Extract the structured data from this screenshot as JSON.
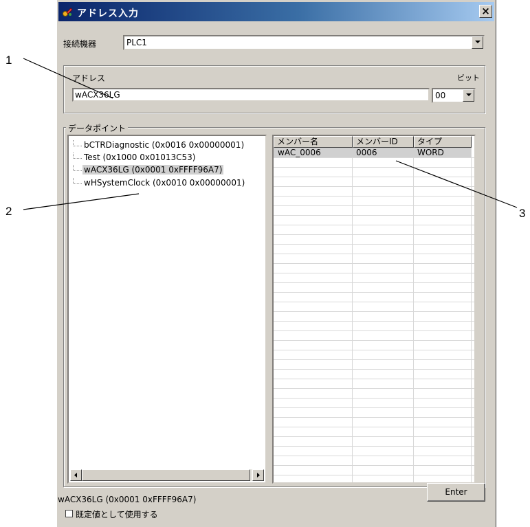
{
  "window": {
    "title": "アドレス入力",
    "close_symbol": "×"
  },
  "device": {
    "label": "接続機器",
    "value": "PLC1"
  },
  "address_group": {
    "label": "アドレス",
    "bit_label": "ビット",
    "value": "wACX36LG",
    "bit_value": "00"
  },
  "datapoint_group": {
    "label": "データポイント",
    "tree_items": [
      "bCTRDiagnostic (0x0016 0x00000001)",
      "Test (0x1000 0x01013C53)",
      "wACX36LG (0x0001 0xFFFF96A7)",
      "wHSystemClock (0x0010 0x00000001)"
    ],
    "selected_index": 2
  },
  "members_table": {
    "columns": [
      "メンバー名",
      "メンバーID",
      "タイプ"
    ],
    "rows": [
      [
        "wAC_0006",
        "0006",
        "WORD"
      ]
    ]
  },
  "status_text": "wACX36LG (0x0001 0xFFFF96A7)",
  "enter_button": "Enter",
  "default_checkbox": {
    "label": "既定値として使用する",
    "checked": false
  },
  "callouts": [
    "1",
    "2",
    "3"
  ]
}
